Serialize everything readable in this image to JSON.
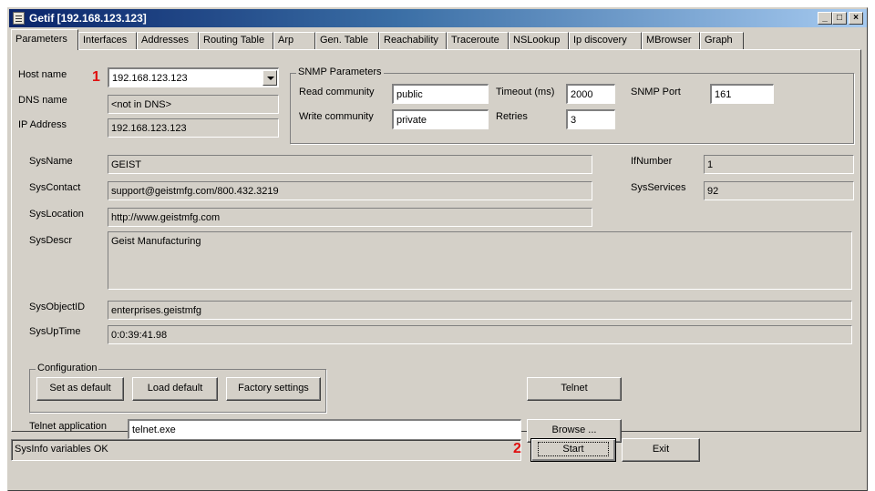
{
  "window": {
    "title": "Getif [192.168.123.123]",
    "buttons": {
      "minimize": "_",
      "maximize": "□",
      "close": "×"
    }
  },
  "tabs": [
    {
      "label": "Parameters",
      "active": true
    },
    {
      "label": "Interfaces"
    },
    {
      "label": "Addresses"
    },
    {
      "label": "Routing Table"
    },
    {
      "label": "Arp"
    },
    {
      "label": "Gen. Table"
    },
    {
      "label": "Reachability"
    },
    {
      "label": "Traceroute"
    },
    {
      "label": "NSLookup"
    },
    {
      "label": "Ip discovery"
    },
    {
      "label": "MBrowser"
    },
    {
      "label": "Graph"
    }
  ],
  "host": {
    "host_label": "Host name",
    "host_value": "192.168.123.123",
    "dns_label": "DNS name",
    "dns_value": "<not in DNS>",
    "ip_label": "IP Address",
    "ip_value": "192.168.123.123"
  },
  "snmp": {
    "group_title": "SNMP Parameters",
    "read_label": "Read community",
    "read_value": "public",
    "write_label": "Write community",
    "write_value": "private",
    "timeout_label": "Timeout (ms)",
    "timeout_value": "2000",
    "retries_label": "Retries",
    "retries_value": "3",
    "port_label": "SNMP Port",
    "port_value": "161"
  },
  "sys": {
    "sysname_label": "SysName",
    "sysname_value": "GEIST",
    "syscontact_label": "SysContact",
    "syscontact_value": "support@geistmfg.com/800.432.3219",
    "syslocation_label": "SysLocation",
    "syslocation_value": "http://www.geistmfg.com",
    "sysdescr_label": "SysDescr",
    "sysdescr_value": "Geist Manufacturing",
    "sysobjectid_label": "SysObjectID",
    "sysobjectid_value": "enterprises.geistmfg",
    "sysuptime_label": "SysUpTime",
    "sysuptime_value": "0:0:39:41.98",
    "ifnumber_label": "IfNumber",
    "ifnumber_value": "1",
    "sysservices_label": "SysServices",
    "sysservices_value": "92"
  },
  "config": {
    "group_title": "Configuration",
    "set_default": "Set as default",
    "load_default": "Load default",
    "factory": "Factory settings",
    "telnet_button": "Telnet",
    "telnet_app_label": "Telnet application",
    "telnet_app_value": "telnet.exe",
    "browse_button": "Browse ..."
  },
  "footer": {
    "status": "SysInfo variables OK",
    "start": "Start",
    "exit": "Exit"
  },
  "annotations": {
    "marker1": "1",
    "marker2": "2",
    "color": "#e01010"
  }
}
